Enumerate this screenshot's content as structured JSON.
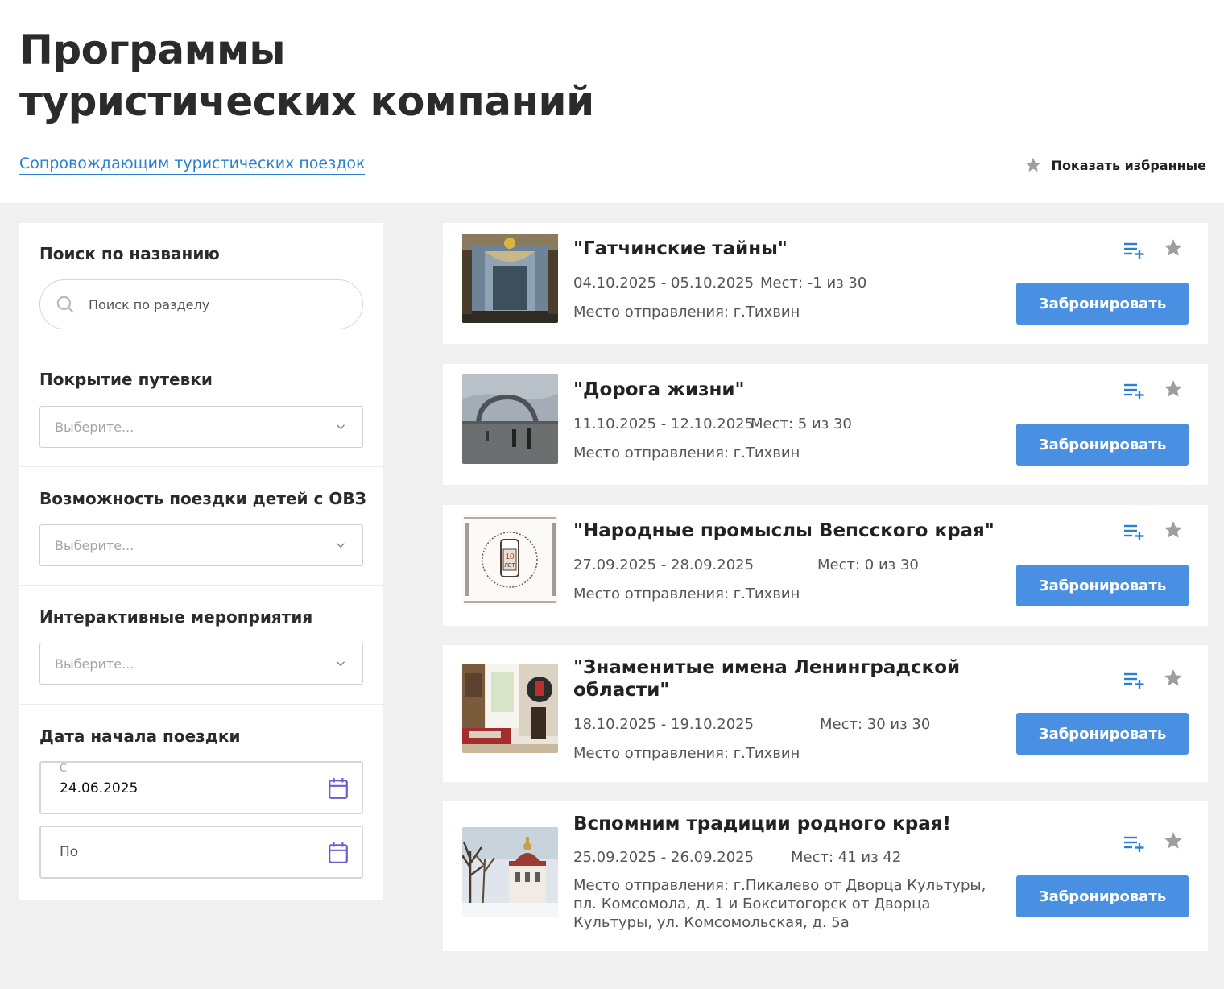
{
  "header": {
    "title": "Программы туристических компаний",
    "guide_link": "Сопровождающим туристических поездок",
    "favorites_toggle": "Показать избранные"
  },
  "filters": {
    "search": {
      "label": "Поиск по названию",
      "placeholder": "Поиск по разделу"
    },
    "coverage": {
      "label": "Покрытие путевки",
      "placeholder": "Выберите..."
    },
    "disabled_children": {
      "label": "Возможность поездки детей с ОВЗ",
      "placeholder": "Выберите..."
    },
    "interactive": {
      "label": "Интерактивные мероприятия",
      "placeholder": "Выберите..."
    },
    "start_date": {
      "label": "Дата начала поездки",
      "from_label": "С",
      "from_value": "24.06.2025",
      "to_placeholder": "По"
    }
  },
  "tours": [
    {
      "title": "\"Гатчинские тайны\"",
      "dates": "04.10.2025 - 05.10.2025",
      "seats": "Мест: -1 из 30",
      "departure": "Место отправления: г.Тихвин",
      "button": "Забронировать"
    },
    {
      "title": "\"Дорога жизни\"",
      "dates": "11.10.2025 - 12.10.2025",
      "seats": "Мест: 5 из 30",
      "departure": "Место отправления: г.Тихвин",
      "button": "Забронировать"
    },
    {
      "title": "\"Народные промыслы Вепсского края\"",
      "dates": "27.09.2025 - 28.09.2025",
      "seats": "Мест: 0 из 30",
      "departure": "Место отправления: г.Тихвин",
      "button": "Забронировать",
      "image_text": {
        "number": "10",
        "word": "ЛЕТ"
      }
    },
    {
      "title": "\"Знаменитые имена Ленинградской области\"",
      "dates": "18.10.2025 - 19.10.2025",
      "seats": "Мест: 30 из 30",
      "departure": "Место отправления: г.Тихвин",
      "button": "Забронировать"
    },
    {
      "title": "Вспомним традиции родного края!",
      "dates": "25.09.2025 - 26.09.2025",
      "seats": "Мест: 41 из 42",
      "departure": "Место отправления: г.Пикалево от Дворца Культуры, пл. Комсомола, д. 1 и Бокситогорск от Дворца Культуры, ул. Комсомольская, д. 5а",
      "button": "Забронировать"
    }
  ],
  "icons": {
    "favorites": "star-icon",
    "search": "search-icon",
    "select": "chevron-down-icon",
    "date": "calendar-icon",
    "add_to_list": "playlist-add-icon"
  },
  "colors": {
    "accent": "#4a90e2",
    "link": "#2a7fd4",
    "calendar": "#6b5bd6",
    "background": "#f0f0f0",
    "star": "#9e9e9e"
  }
}
